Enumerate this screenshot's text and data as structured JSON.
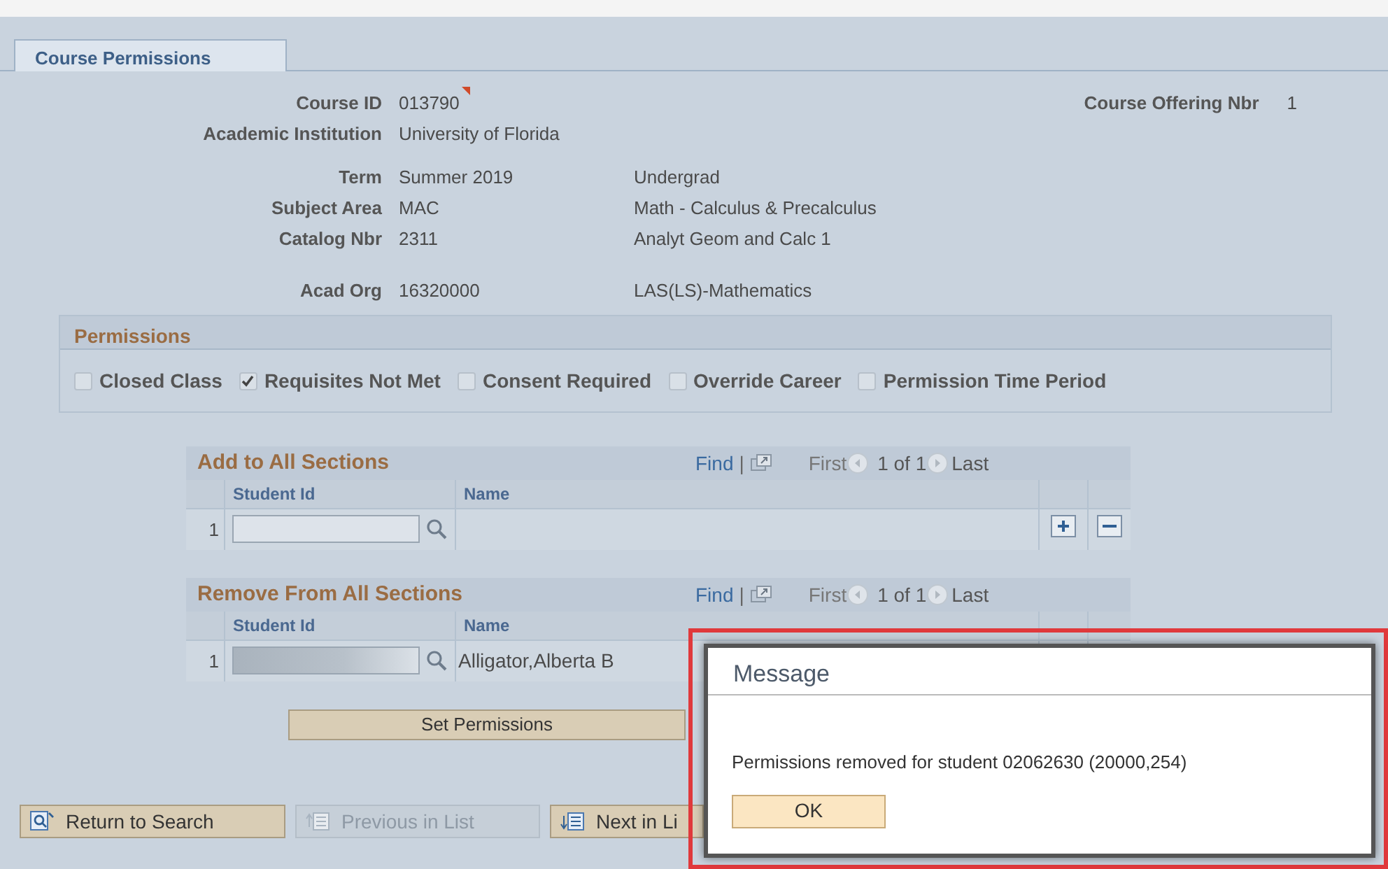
{
  "tab": {
    "label": "Course Permissions",
    "selected": true
  },
  "offering": {
    "label": "Course Offering Nbr",
    "value": "1"
  },
  "field_groups": [
    [
      {
        "label": "Course ID",
        "value": "013790",
        "flagged": true
      },
      {
        "label": "Academic Institution",
        "value": "University of Florida",
        "flagged": false
      }
    ],
    [
      {
        "label": "Term",
        "value": "Summer 2019",
        "description": "Undergrad",
        "flagged": false
      },
      {
        "label": "Subject Area",
        "value": "MAC",
        "description": "Math - Calculus & Precalculus",
        "flagged": false
      },
      {
        "label": "Catalog Nbr",
        "value": "2311",
        "description": "Analyt Geom and Calc 1",
        "flagged": false
      }
    ],
    [
      {
        "label": "Acad Org",
        "value": "16320000",
        "description": "LAS(LS)-Mathematics",
        "flagged": false
      }
    ]
  ],
  "permissions": {
    "title": "Permissions",
    "options": [
      {
        "label": "Closed Class",
        "checked": false
      },
      {
        "label": "Requisites Not Met",
        "checked": true
      },
      {
        "label": "Consent Required",
        "checked": false
      },
      {
        "label": "Override Career",
        "checked": false
      },
      {
        "label": "Permission Time Period",
        "checked": false
      }
    ]
  },
  "grids": [
    {
      "title": "Add to All Sections",
      "find": "Find",
      "separator": "|",
      "first": "First",
      "count": "1 of 1",
      "last": "Last",
      "columns": [
        "Student Id",
        "Name"
      ],
      "row_buttons": true,
      "rows": [
        {
          "number": "1",
          "redacted": false
        }
      ]
    },
    {
      "title": "Remove From All Sections",
      "find": "Find",
      "separator": "|",
      "first": "First",
      "count": "1 of 1",
      "last": "Last",
      "columns": [
        "Student Id",
        "Name"
      ],
      "row_buttons": false,
      "rows": [
        {
          "number": "1",
          "redacted": true,
          "name": "Alligator,Alberta B"
        }
      ]
    }
  ],
  "set_button": "Set Permissions",
  "toolbar": [
    {
      "label": "Return to Search",
      "kind": "search",
      "disabled": false
    },
    {
      "label": "Previous in List",
      "kind": "prev",
      "disabled": true
    },
    {
      "label": "Next in Li",
      "kind": "next",
      "disabled": false
    }
  ],
  "dialog": {
    "title": "Message",
    "text": "Permissions removed for student 02062630 (20000,254)",
    "button": "OK",
    "highlighted": true
  }
}
